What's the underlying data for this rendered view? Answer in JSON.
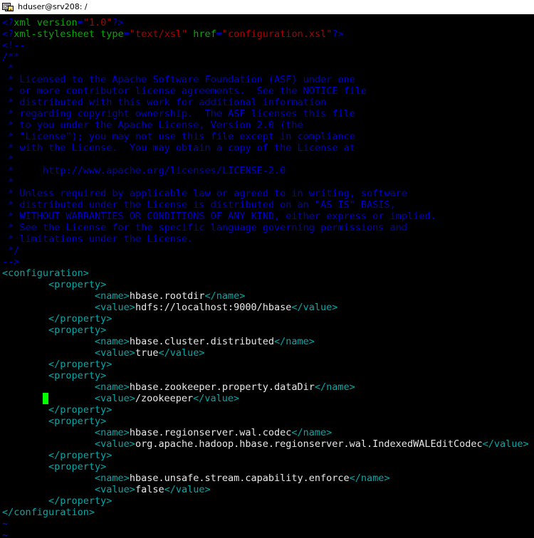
{
  "titlebar": {
    "icon": "putty-terminal-icon",
    "title": "hduser@srv208: /"
  },
  "terminal": {
    "background": "#000000",
    "cursor_color": "#00ff00",
    "colors": {
      "tag": "#00aaaa",
      "text": "#e8e8e8",
      "pi_delim": "#0000cc",
      "pi_name": "#00aa00",
      "attribute": "#00aa00",
      "string": "#aa0000",
      "comment": "#0000cc",
      "tilde": "#1818b2"
    },
    "lines": [
      {
        "segments": [
          {
            "cls": "c-pi",
            "t": "<?"
          },
          {
            "cls": "c-pi-name",
            "t": "xml version"
          },
          {
            "cls": "c-pi",
            "t": "="
          },
          {
            "cls": "c-string",
            "t": "\"1.0\""
          },
          {
            "cls": "c-pi",
            "t": "?>"
          }
        ]
      },
      {
        "segments": [
          {
            "cls": "c-pi",
            "t": "<?"
          },
          {
            "cls": "c-pi-name",
            "t": "xml-stylesheet type"
          },
          {
            "cls": "c-pi",
            "t": "="
          },
          {
            "cls": "c-string",
            "t": "\"text/xsl\""
          },
          {
            "cls": "c-pi-name",
            "t": " href"
          },
          {
            "cls": "c-pi",
            "t": "="
          },
          {
            "cls": "c-string",
            "t": "\"configuration.xsl\""
          },
          {
            "cls": "c-pi",
            "t": "?>"
          }
        ]
      },
      {
        "segments": [
          {
            "cls": "c-comment",
            "t": "<!--"
          }
        ]
      },
      {
        "segments": [
          {
            "cls": "c-comment",
            "t": "/**"
          }
        ]
      },
      {
        "segments": [
          {
            "cls": "c-comment",
            "t": " *"
          }
        ]
      },
      {
        "segments": [
          {
            "cls": "c-comment",
            "t": " * Licensed to the Apache Software Foundation (ASF) under one"
          }
        ]
      },
      {
        "segments": [
          {
            "cls": "c-comment",
            "t": " * or more contributor license agreements.  See the NOTICE file"
          }
        ]
      },
      {
        "segments": [
          {
            "cls": "c-comment",
            "t": " * distributed with this work for additional information"
          }
        ]
      },
      {
        "segments": [
          {
            "cls": "c-comment",
            "t": " * regarding copyright ownership.  The ASF licenses this file"
          }
        ]
      },
      {
        "segments": [
          {
            "cls": "c-comment",
            "t": " * to you under the Apache License, Version 2.0 (the"
          }
        ]
      },
      {
        "segments": [
          {
            "cls": "c-comment",
            "t": " * \"License\"); you may not use this file except in compliance"
          }
        ]
      },
      {
        "segments": [
          {
            "cls": "c-comment",
            "t": " * with the License.  You may obtain a copy of the License at"
          }
        ]
      },
      {
        "segments": [
          {
            "cls": "c-comment",
            "t": " *"
          }
        ]
      },
      {
        "segments": [
          {
            "cls": "c-comment",
            "t": " *     http://www.apache.org/licenses/LICENSE-2.0"
          }
        ]
      },
      {
        "segments": [
          {
            "cls": "c-comment",
            "t": " *"
          }
        ]
      },
      {
        "segments": [
          {
            "cls": "c-comment",
            "t": " * Unless required by applicable law or agreed to in writing, software"
          }
        ]
      },
      {
        "segments": [
          {
            "cls": "c-comment",
            "t": " * distributed under the License is distributed on an \"AS IS\" BASIS,"
          }
        ]
      },
      {
        "segments": [
          {
            "cls": "c-comment",
            "t": " * WITHOUT WARRANTIES OR CONDITIONS OF ANY KIND, either express or implied."
          }
        ]
      },
      {
        "segments": [
          {
            "cls": "c-comment",
            "t": " * See the License for the specific language governing permissions and"
          }
        ]
      },
      {
        "segments": [
          {
            "cls": "c-comment",
            "t": " * limitations under the License."
          }
        ]
      },
      {
        "segments": [
          {
            "cls": "c-comment",
            "t": " */"
          }
        ]
      },
      {
        "segments": [
          {
            "cls": "c-comment",
            "t": "-->"
          }
        ]
      },
      {
        "segments": [
          {
            "cls": "c-tag",
            "t": "<configuration>"
          }
        ]
      },
      {
        "segments": [
          {
            "cls": "c-tag",
            "t": "        <property>"
          }
        ]
      },
      {
        "segments": [
          {
            "cls": "c-tag",
            "t": "                <name>"
          },
          {
            "cls": "c-text",
            "t": "hbase.rootdir"
          },
          {
            "cls": "c-tag",
            "t": "</name>"
          }
        ]
      },
      {
        "segments": [
          {
            "cls": "c-tag",
            "t": "                <value>"
          },
          {
            "cls": "c-text",
            "t": "hdfs://localhost:9000/hbase"
          },
          {
            "cls": "c-tag",
            "t": "</value>"
          }
        ]
      },
      {
        "segments": [
          {
            "cls": "c-tag",
            "t": "        </property>"
          }
        ]
      },
      {
        "segments": [
          {
            "cls": "c-tag",
            "t": "        <property>"
          }
        ]
      },
      {
        "segments": [
          {
            "cls": "c-tag",
            "t": "                <name>"
          },
          {
            "cls": "c-text",
            "t": "hbase.cluster.distributed"
          },
          {
            "cls": "c-tag",
            "t": "</name>"
          }
        ]
      },
      {
        "segments": [
          {
            "cls": "c-tag",
            "t": "                <value>"
          },
          {
            "cls": "c-text",
            "t": "true"
          },
          {
            "cls": "c-tag",
            "t": "</value>"
          }
        ]
      },
      {
        "segments": [
          {
            "cls": "c-tag",
            "t": "        </property>"
          }
        ]
      },
      {
        "segments": [
          {
            "cls": "c-tag",
            "t": "        <property>"
          }
        ]
      },
      {
        "segments": [
          {
            "cls": "c-tag",
            "t": "                <name>"
          },
          {
            "cls": "c-text",
            "t": "hbase.zookeeper.property.dataDir"
          },
          {
            "cls": "c-tag",
            "t": "</name>"
          }
        ]
      },
      {
        "cursor_col": 7,
        "segments": [
          {
            "cls": "c-tag",
            "t": "                <value>"
          },
          {
            "cls": "c-text",
            "t": "/zookeeper"
          },
          {
            "cls": "c-tag",
            "t": "</value>"
          }
        ]
      },
      {
        "segments": [
          {
            "cls": "c-tag",
            "t": "        </property>"
          }
        ]
      },
      {
        "segments": [
          {
            "cls": "c-tag",
            "t": "        <property>"
          }
        ]
      },
      {
        "segments": [
          {
            "cls": "c-tag",
            "t": "                <name>"
          },
          {
            "cls": "c-text",
            "t": "hbase.regionserver.wal.codec"
          },
          {
            "cls": "c-tag",
            "t": "</name>"
          }
        ]
      },
      {
        "segments": [
          {
            "cls": "c-tag",
            "t": "                <value>"
          },
          {
            "cls": "c-text",
            "t": "org.apache.hadoop.hbase.regionserver.wal.IndexedWALEditCodec"
          },
          {
            "cls": "c-tag",
            "t": "</value>"
          }
        ]
      },
      {
        "segments": [
          {
            "cls": "c-tag",
            "t": "        </property>"
          }
        ]
      },
      {
        "segments": [
          {
            "cls": "c-tag",
            "t": "        <property>"
          }
        ]
      },
      {
        "segments": [
          {
            "cls": "c-tag",
            "t": "                <name>"
          },
          {
            "cls": "c-text",
            "t": "hbase.unsafe.stream.capability.enforce"
          },
          {
            "cls": "c-tag",
            "t": "</name>"
          }
        ]
      },
      {
        "segments": [
          {
            "cls": "c-tag",
            "t": "                <value>"
          },
          {
            "cls": "c-text",
            "t": "false"
          },
          {
            "cls": "c-tag",
            "t": "</value>"
          }
        ]
      },
      {
        "segments": [
          {
            "cls": "c-tag",
            "t": "        </property>"
          }
        ]
      },
      {
        "segments": [
          {
            "cls": "c-tag",
            "t": "</configuration>"
          }
        ]
      },
      {
        "segments": [
          {
            "cls": "c-tilde",
            "t": "~"
          }
        ]
      },
      {
        "segments": [
          {
            "cls": "c-tilde",
            "t": "~"
          }
        ]
      }
    ]
  }
}
